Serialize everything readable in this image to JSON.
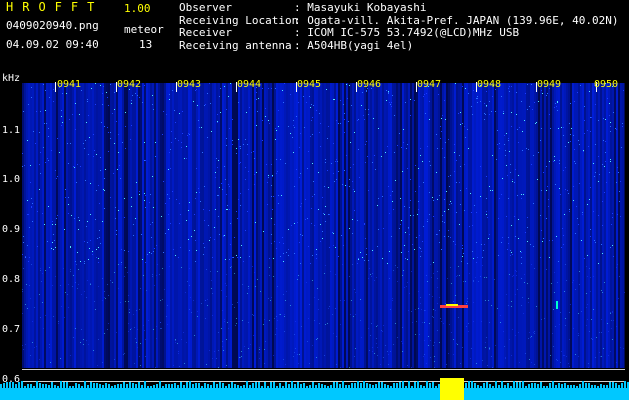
{
  "header": {
    "app_title": "HROFFT",
    "version": "1.00",
    "filename": "0409020940.png",
    "datetime": "04.09.02 09:40",
    "meteor_label": "meteor",
    "meteor_count": "13"
  },
  "info": {
    "observer_label": "Observer",
    "observer_value": "Masayuki Kobayashi",
    "location_label": "Receiving Location",
    "location_value": "Ogata-vill. Akita-Pref. JAPAN (139.96E, 40.02N)",
    "receiver_label": "Receiver",
    "receiver_value": "ICOM IC-575 53.7492(@LCD)MHz USB",
    "antenna_label": "Receiving antenna",
    "antenna_value": "A504HB(yagi 4el)"
  },
  "axis": {
    "unit": "kHz",
    "freq_labels": [
      "1.1",
      "1.0",
      "0.9",
      "0.8",
      "0.7",
      "0.6"
    ],
    "time_labels": [
      "0941",
      "0942",
      "0943",
      "0944",
      "0945",
      "0946",
      "0947",
      "0948",
      "0949",
      "0950"
    ]
  },
  "colors": {
    "background": "#000000",
    "title": "#ffff00",
    "time_label": "#ffff00",
    "spectrum_base": "#00008c",
    "noise": "#00c8ff",
    "meteor_burst": "#ffff00"
  }
}
